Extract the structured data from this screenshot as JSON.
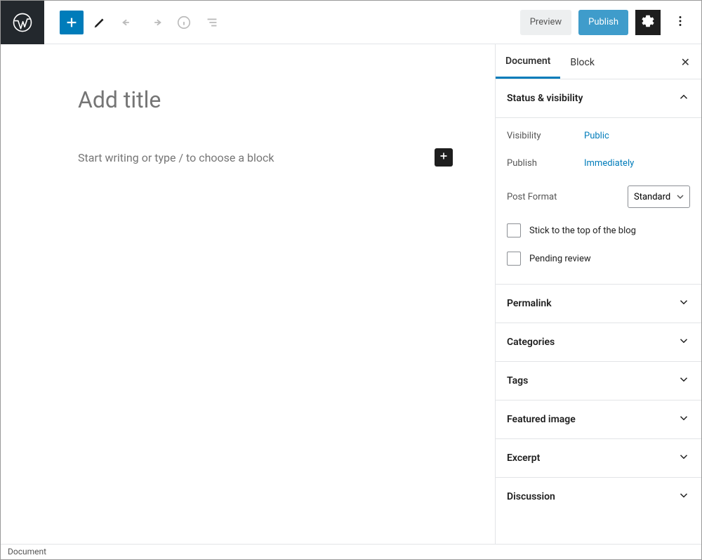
{
  "toolbar": {
    "preview_label": "Preview",
    "publish_label": "Publish"
  },
  "editor": {
    "title_placeholder": "Add title",
    "block_placeholder": "Start writing or type / to choose a block"
  },
  "sidebar": {
    "tabs": {
      "document": "Document",
      "block": "Block"
    },
    "panels": {
      "status": {
        "title": "Status & visibility",
        "visibility_label": "Visibility",
        "visibility_value": "Public",
        "publish_label": "Publish",
        "publish_value": "Immediately",
        "format_label": "Post Format",
        "format_value": "Standard",
        "sticky_label": "Stick to the top of the blog",
        "pending_label": "Pending review"
      },
      "permalink": "Permalink",
      "categories": "Categories",
      "tags": "Tags",
      "featured": "Featured image",
      "excerpt": "Excerpt",
      "discussion": "Discussion"
    }
  },
  "footer": {
    "breadcrumb": "Document"
  }
}
